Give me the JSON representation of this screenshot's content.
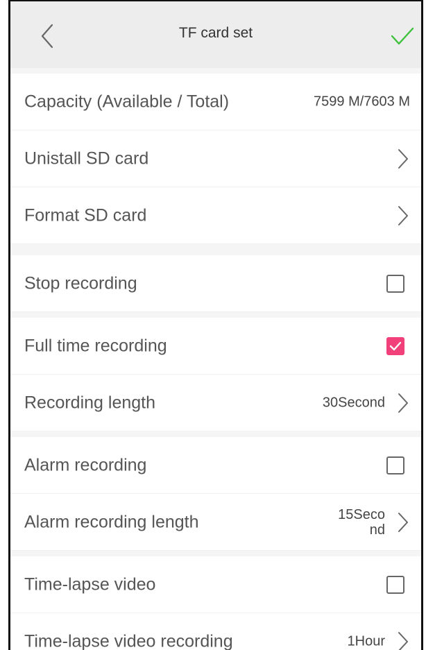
{
  "header": {
    "title": "TF card set"
  },
  "rows": [
    {
      "label": "Capacity (Available / Total)",
      "value": "7599 M/7603 M"
    },
    {
      "label": "Unistall SD card"
    },
    {
      "label": "Format SD card"
    },
    {
      "label": "Stop recording",
      "checked": false
    },
    {
      "label": "Full time recording",
      "checked": true
    },
    {
      "label": "Recording length",
      "value": "30Second"
    },
    {
      "label": "Alarm recording",
      "checked": false
    },
    {
      "label": "Alarm recording length",
      "value": "15Second"
    },
    {
      "label": "Time-lapse video",
      "checked": false
    },
    {
      "label": "Time-lapse video recording",
      "value": "1Hour"
    }
  ],
  "colors": {
    "accent": "#f2407a",
    "confirm": "#3cc13c",
    "header_bg": "#ededed"
  },
  "icons": [
    "chevron-left-icon",
    "checkmark-icon",
    "chevron-right-icon",
    "checkbox-icon"
  ]
}
